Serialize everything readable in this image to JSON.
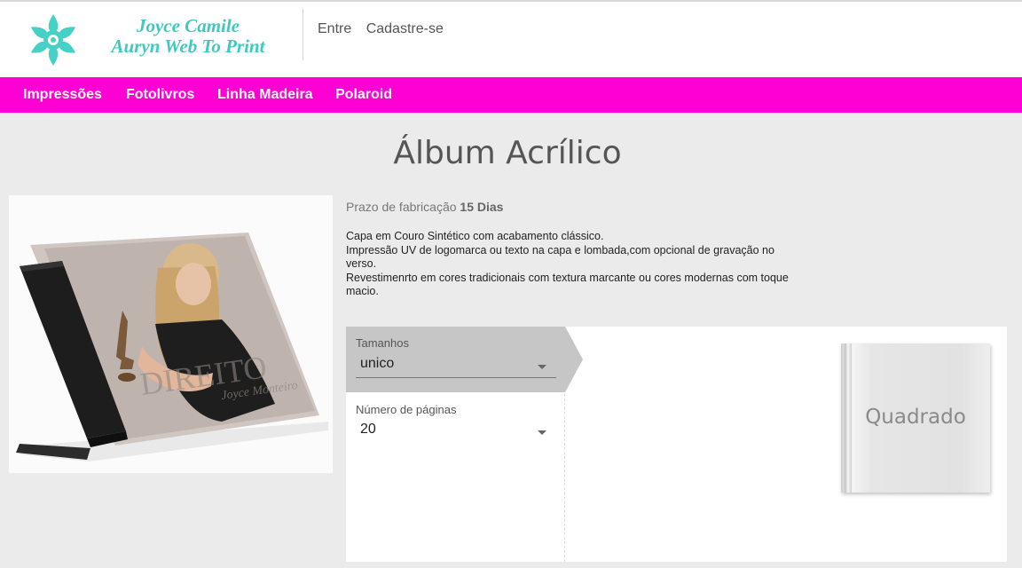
{
  "brand": {
    "line1": "Joyce Camile",
    "line2": "Auryn Web To Print",
    "color": "#3fc9c0"
  },
  "auth": {
    "login": "Entre",
    "signup": "Cadastre-se"
  },
  "nav": {
    "color": "#ff00d4",
    "items": [
      {
        "label": "Impressões"
      },
      {
        "label": "Fotolivros"
      },
      {
        "label": "Linha Madeira"
      },
      {
        "label": "Polaroid"
      }
    ]
  },
  "product": {
    "title": "Álbum Acrílico",
    "lead_label": "Prazo de fabricação",
    "lead_value": "15 Dias",
    "description": [
      "Capa em Couro Sintético com acabamento clássico.",
      "Impressão UV de logomarca ou texto na capa e lombada,com opcional de gravação no verso.",
      "Revestimenrto em cores tradicionais com textura marcante ou cores modernas com toque macio."
    ]
  },
  "options": {
    "size": {
      "label": "Tamanhos",
      "value": "unico"
    },
    "pages": {
      "label": "Número de páginas",
      "value": "20"
    }
  },
  "preview": {
    "label": "Quadrado"
  }
}
